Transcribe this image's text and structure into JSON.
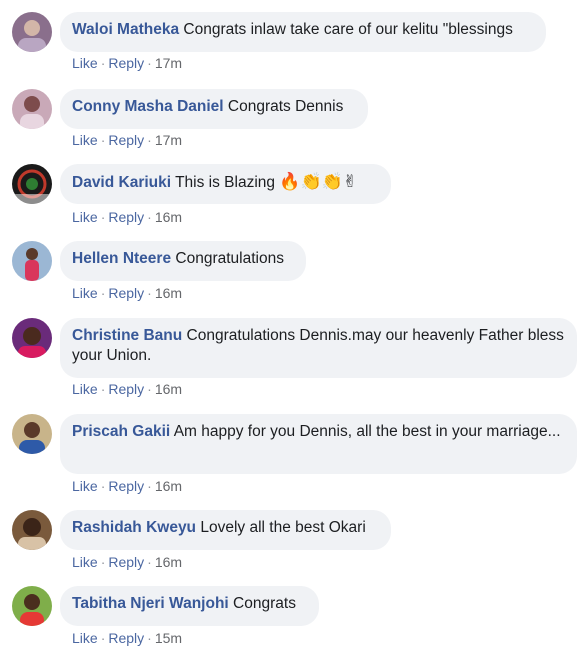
{
  "comments": [
    {
      "author": "Waloi Matheka",
      "text": "Congrats inlaw take care of our kelitu \"blessings",
      "like": "Like",
      "reply": "Reply",
      "time": "17m",
      "sep": "·"
    },
    {
      "author": "Conny Masha Daniel",
      "text": "Congrats Dennis",
      "like": "Like",
      "reply": "Reply",
      "time": "17m",
      "sep": "·"
    },
    {
      "author": "David Kariuki",
      "text": "This is Blazing",
      "emoji": "🔥👏👏✌",
      "like": "Like",
      "reply": "Reply",
      "time": "16m",
      "sep": "·"
    },
    {
      "author": "Hellen Nteere",
      "text": "Congratulations",
      "like": "Like",
      "reply": "Reply",
      "time": "16m",
      "sep": "·"
    },
    {
      "author": "Christine Banu",
      "text": "Congratulations Dennis.may our heavenly Father bless your Union.",
      "like": "Like",
      "reply": "Reply",
      "time": "16m",
      "sep": "·"
    },
    {
      "author": "Priscah Gakii",
      "text": "Am happy for you Dennis, all the best in your marriage...",
      "like": "Like",
      "reply": "Reply",
      "time": "16m",
      "sep": "·"
    },
    {
      "author": "Rashidah Kweyu",
      "text": "Lovely all the best Okari",
      "like": "Like",
      "reply": "Reply",
      "time": "16m",
      "sep": "·"
    },
    {
      "author": "Tabitha Njeri Wanjohi",
      "text": "Congrats",
      "like": "Like",
      "reply": "Reply",
      "time": "15m",
      "sep": "·"
    }
  ],
  "colors": {
    "bubble": "#f0f2f5",
    "author": "#385898",
    "link": "#4b67a1",
    "muted": "#65676b"
  }
}
